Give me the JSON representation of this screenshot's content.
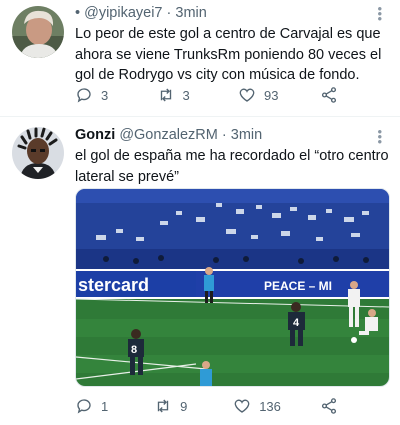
{
  "tweets": [
    {
      "handle_prefix": "•",
      "handle": "@yipikayei7",
      "sep": "·",
      "time": "3min",
      "text": "Lo peor de este gol a centro de Carvajal es que ahora se viene TrunksRm poniendo 80 veces el gol de Rodrygo vs city con música de fondo.",
      "replies": "3",
      "retweets": "3",
      "likes": "93"
    },
    {
      "name": "Gonzi",
      "handle": "@GonzalezRM",
      "sep": "·",
      "time": "3min",
      "text": "el gol de españa me ha recordado el “otro centro lateral se prevé”",
      "media": {
        "board_text_1": "stercard",
        "board_text_2": "PEACE – MI",
        "player_number_1": "8",
        "player_number_2": "4"
      },
      "replies": "1",
      "retweets": "9",
      "likes": "136"
    }
  ],
  "colors": {
    "text": "#0f1419",
    "muted": "#536471",
    "divider": "#eff3f4",
    "pitch": "#2f7a37",
    "board": "#1f3fa8"
  },
  "icons": [
    "more-icon",
    "reply-icon",
    "retweet-icon",
    "like-icon",
    "share-icon",
    "avatar"
  ]
}
